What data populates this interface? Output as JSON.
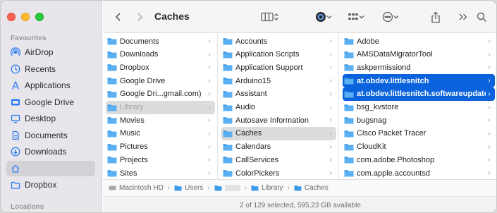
{
  "window": {
    "title": "Caches"
  },
  "sidebar": {
    "favourites_heading": "Favourites",
    "items": [
      {
        "label": "AirDrop",
        "icon": "airdrop-icon"
      },
      {
        "label": "Recents",
        "icon": "clock-icon"
      },
      {
        "label": "Applications",
        "icon": "applications-icon"
      },
      {
        "label": "Google Drive",
        "icon": "drive-icon"
      },
      {
        "label": "Desktop",
        "icon": "desktop-icon"
      },
      {
        "label": "Documents",
        "icon": "document-icon"
      },
      {
        "label": "Downloads",
        "icon": "download-icon"
      },
      {
        "label": "",
        "icon": "home-icon"
      },
      {
        "label": "Dropbox",
        "icon": "folder-icon"
      }
    ],
    "locations_heading": "Locations"
  },
  "columns": [
    {
      "items": [
        {
          "label": "Documents"
        },
        {
          "label": "Downloads"
        },
        {
          "label": "Dropbox"
        },
        {
          "label": "Google Drive"
        },
        {
          "label": "Google Dri...gmail.com)"
        },
        {
          "label": "Library"
        },
        {
          "label": "Movies"
        },
        {
          "label": "Music"
        },
        {
          "label": "Pictures"
        },
        {
          "label": "Projects"
        },
        {
          "label": "Sites"
        }
      ]
    },
    {
      "items": [
        {
          "label": "Accounts"
        },
        {
          "label": "Application Scripts"
        },
        {
          "label": "Application Support"
        },
        {
          "label": "Arduino15"
        },
        {
          "label": "Assistant"
        },
        {
          "label": "Audio"
        },
        {
          "label": "Autosave Information"
        },
        {
          "label": "Caches"
        },
        {
          "label": "Calendars"
        },
        {
          "label": "CallServices"
        },
        {
          "label": "ColorPickers"
        }
      ]
    },
    {
      "items": [
        {
          "label": "Adobe"
        },
        {
          "label": "AMSDataMigratorTool"
        },
        {
          "label": "askpermissiond"
        },
        {
          "label": "at.obdev.littlesnitch"
        },
        {
          "label": "at.obdev.littlesnitch.softwareupdate"
        },
        {
          "label": "bsg_kvstore"
        },
        {
          "label": "bugsnag"
        },
        {
          "label": "Cisco Packet Tracer"
        },
        {
          "label": "CloudKit"
        },
        {
          "label": "com.adobe.Photoshop"
        },
        {
          "label": "com.apple.accountsd"
        }
      ]
    }
  ],
  "pathbar": {
    "crumbs": [
      {
        "label": "Macintosh HD"
      },
      {
        "label": "Users"
      },
      {
        "label": ""
      },
      {
        "label": "Library"
      },
      {
        "label": "Caches"
      }
    ]
  },
  "status": {
    "text": "2 of 129 selected, 595,23 GB available"
  },
  "colors": {
    "accent": "#0a63dc",
    "folder": "#3d9ae8",
    "sidebar_icon": "#2c7cf6"
  }
}
